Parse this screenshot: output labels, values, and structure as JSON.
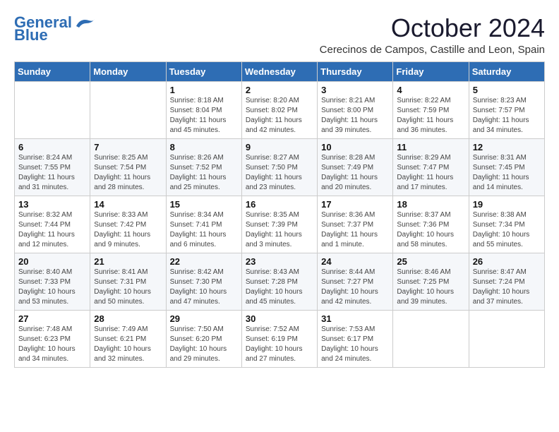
{
  "logo": {
    "line1": "General",
    "line2": "Blue"
  },
  "header": {
    "month": "October 2024",
    "location": "Cerecinos de Campos, Castille and Leon, Spain"
  },
  "days_of_week": [
    "Sunday",
    "Monday",
    "Tuesday",
    "Wednesday",
    "Thursday",
    "Friday",
    "Saturday"
  ],
  "weeks": [
    [
      {
        "day": "",
        "info": ""
      },
      {
        "day": "",
        "info": ""
      },
      {
        "day": "1",
        "info": "Sunrise: 8:18 AM\nSunset: 8:04 PM\nDaylight: 11 hours and 45 minutes."
      },
      {
        "day": "2",
        "info": "Sunrise: 8:20 AM\nSunset: 8:02 PM\nDaylight: 11 hours and 42 minutes."
      },
      {
        "day": "3",
        "info": "Sunrise: 8:21 AM\nSunset: 8:00 PM\nDaylight: 11 hours and 39 minutes."
      },
      {
        "day": "4",
        "info": "Sunrise: 8:22 AM\nSunset: 7:59 PM\nDaylight: 11 hours and 36 minutes."
      },
      {
        "day": "5",
        "info": "Sunrise: 8:23 AM\nSunset: 7:57 PM\nDaylight: 11 hours and 34 minutes."
      }
    ],
    [
      {
        "day": "6",
        "info": "Sunrise: 8:24 AM\nSunset: 7:55 PM\nDaylight: 11 hours and 31 minutes."
      },
      {
        "day": "7",
        "info": "Sunrise: 8:25 AM\nSunset: 7:54 PM\nDaylight: 11 hours and 28 minutes."
      },
      {
        "day": "8",
        "info": "Sunrise: 8:26 AM\nSunset: 7:52 PM\nDaylight: 11 hours and 25 minutes."
      },
      {
        "day": "9",
        "info": "Sunrise: 8:27 AM\nSunset: 7:50 PM\nDaylight: 11 hours and 23 minutes."
      },
      {
        "day": "10",
        "info": "Sunrise: 8:28 AM\nSunset: 7:49 PM\nDaylight: 11 hours and 20 minutes."
      },
      {
        "day": "11",
        "info": "Sunrise: 8:29 AM\nSunset: 7:47 PM\nDaylight: 11 hours and 17 minutes."
      },
      {
        "day": "12",
        "info": "Sunrise: 8:31 AM\nSunset: 7:45 PM\nDaylight: 11 hours and 14 minutes."
      }
    ],
    [
      {
        "day": "13",
        "info": "Sunrise: 8:32 AM\nSunset: 7:44 PM\nDaylight: 11 hours and 12 minutes."
      },
      {
        "day": "14",
        "info": "Sunrise: 8:33 AM\nSunset: 7:42 PM\nDaylight: 11 hours and 9 minutes."
      },
      {
        "day": "15",
        "info": "Sunrise: 8:34 AM\nSunset: 7:41 PM\nDaylight: 11 hours and 6 minutes."
      },
      {
        "day": "16",
        "info": "Sunrise: 8:35 AM\nSunset: 7:39 PM\nDaylight: 11 hours and 3 minutes."
      },
      {
        "day": "17",
        "info": "Sunrise: 8:36 AM\nSunset: 7:37 PM\nDaylight: 11 hours and 1 minute."
      },
      {
        "day": "18",
        "info": "Sunrise: 8:37 AM\nSunset: 7:36 PM\nDaylight: 10 hours and 58 minutes."
      },
      {
        "day": "19",
        "info": "Sunrise: 8:38 AM\nSunset: 7:34 PM\nDaylight: 10 hours and 55 minutes."
      }
    ],
    [
      {
        "day": "20",
        "info": "Sunrise: 8:40 AM\nSunset: 7:33 PM\nDaylight: 10 hours and 53 minutes."
      },
      {
        "day": "21",
        "info": "Sunrise: 8:41 AM\nSunset: 7:31 PM\nDaylight: 10 hours and 50 minutes."
      },
      {
        "day": "22",
        "info": "Sunrise: 8:42 AM\nSunset: 7:30 PM\nDaylight: 10 hours and 47 minutes."
      },
      {
        "day": "23",
        "info": "Sunrise: 8:43 AM\nSunset: 7:28 PM\nDaylight: 10 hours and 45 minutes."
      },
      {
        "day": "24",
        "info": "Sunrise: 8:44 AM\nSunset: 7:27 PM\nDaylight: 10 hours and 42 minutes."
      },
      {
        "day": "25",
        "info": "Sunrise: 8:46 AM\nSunset: 7:25 PM\nDaylight: 10 hours and 39 minutes."
      },
      {
        "day": "26",
        "info": "Sunrise: 8:47 AM\nSunset: 7:24 PM\nDaylight: 10 hours and 37 minutes."
      }
    ],
    [
      {
        "day": "27",
        "info": "Sunrise: 7:48 AM\nSunset: 6:23 PM\nDaylight: 10 hours and 34 minutes."
      },
      {
        "day": "28",
        "info": "Sunrise: 7:49 AM\nSunset: 6:21 PM\nDaylight: 10 hours and 32 minutes."
      },
      {
        "day": "29",
        "info": "Sunrise: 7:50 AM\nSunset: 6:20 PM\nDaylight: 10 hours and 29 minutes."
      },
      {
        "day": "30",
        "info": "Sunrise: 7:52 AM\nSunset: 6:19 PM\nDaylight: 10 hours and 27 minutes."
      },
      {
        "day": "31",
        "info": "Sunrise: 7:53 AM\nSunset: 6:17 PM\nDaylight: 10 hours and 24 minutes."
      },
      {
        "day": "",
        "info": ""
      },
      {
        "day": "",
        "info": ""
      }
    ]
  ]
}
